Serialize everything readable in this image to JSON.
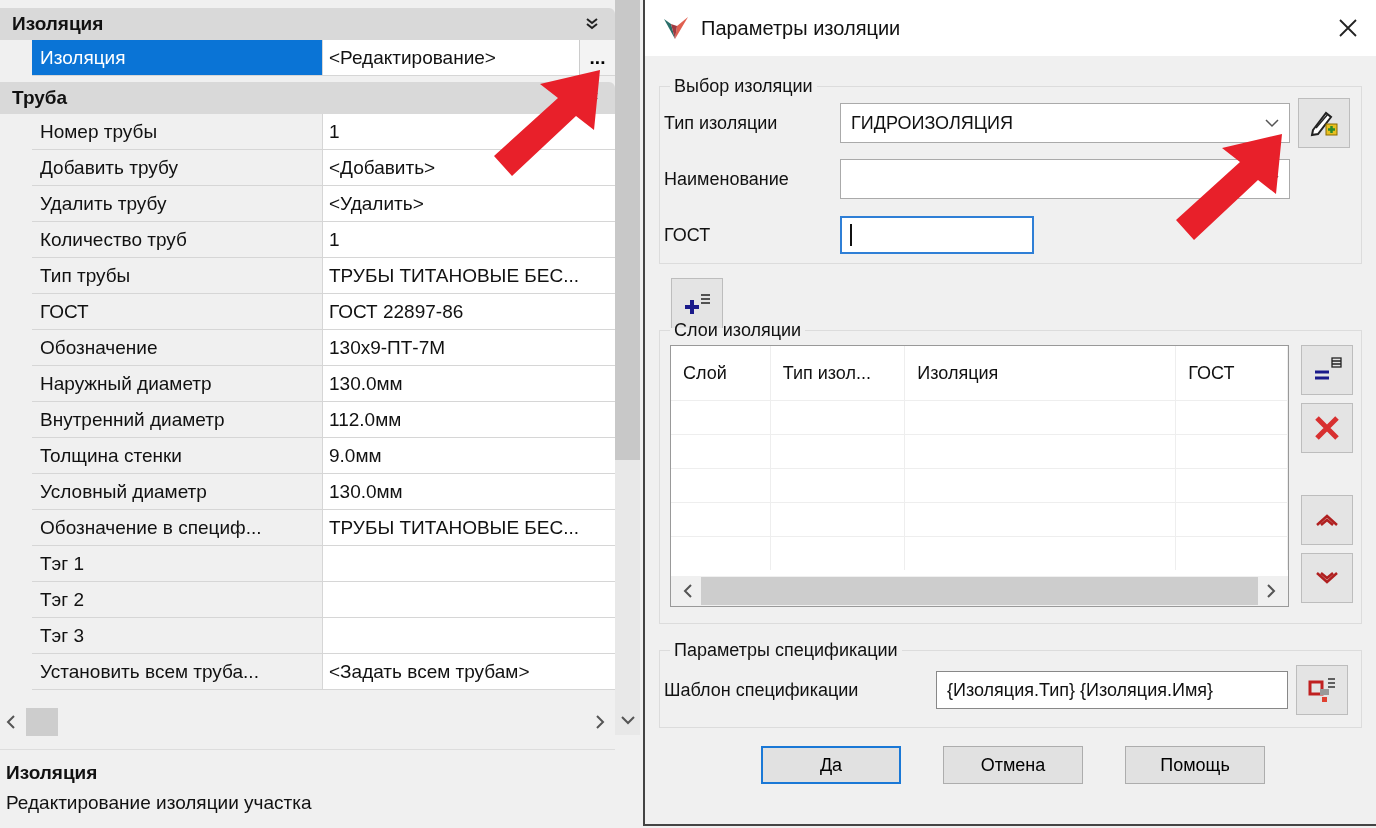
{
  "property_panel": {
    "categories": [
      {
        "title": "Изоляция",
        "rows": [
          {
            "label": "Изоляция",
            "value": "<Редактирование>",
            "selected": true,
            "button": "..."
          }
        ]
      },
      {
        "title": "Труба",
        "rows": [
          {
            "label": "Номер трубы",
            "value": "1",
            "selected": false
          },
          {
            "label": "Добавить трубу",
            "value": "<Добавить>",
            "selected": false
          },
          {
            "label": "Удалить трубу",
            "value": "<Удалить>",
            "selected": false
          },
          {
            "label": "Количество труб",
            "value": "1",
            "selected": false
          },
          {
            "label": "Тип трубы",
            "value": "ТРУБЫ ТИТАНОВЫЕ БЕС...",
            "selected": false
          },
          {
            "label": "ГОСТ",
            "value": "ГОСТ 22897-86",
            "selected": false
          },
          {
            "label": "Обозначение",
            "value": "130x9-ПТ-7М",
            "selected": false
          },
          {
            "label": "Наружный диаметр",
            "value": "130.0мм",
            "selected": false
          },
          {
            "label": "Внутренний диаметр",
            "value": "112.0мм",
            "selected": false
          },
          {
            "label": "Толщина стенки",
            "value": "9.0мм",
            "selected": false
          },
          {
            "label": "Условный диаметр",
            "value": "130.0мм",
            "selected": false
          },
          {
            "label": "Обозначение в специф...",
            "value": "ТРУБЫ ТИТАНОВЫЕ БЕС...",
            "selected": false
          },
          {
            "label": "Тэг 1",
            "selected": false
          },
          {
            "label": "Тэг 2",
            "selected": false
          },
          {
            "label": "Тэг 3",
            "selected": false
          },
          {
            "label": "Установить всем труба...",
            "value": "<Задать всем трубам>",
            "selected": false
          }
        ]
      }
    ]
  },
  "description": {
    "title": "Изоляция",
    "text": "Редактирование изоляции участка"
  },
  "dialog": {
    "title": "Параметры изоляции",
    "selection": {
      "title": "Выбор изоляции",
      "fields": [
        {
          "label": "Тип изоляции",
          "kind": "combo",
          "value": "ГИДРОИЗОЛЯЦИЯ",
          "focused": false
        },
        {
          "label": "Наименование",
          "kind": "combo",
          "focused": false
        },
        {
          "label": "ГОСТ",
          "kind": "input",
          "focused": true
        }
      ]
    },
    "layers": {
      "title": "Слои изоляции",
      "columns": [
        "Слой",
        "Тип изол...",
        "Изоляция",
        "ГОСТ"
      ]
    },
    "spec": {
      "title": "Параметры спецификации",
      "label": "Шаблон спецификации",
      "value": "{Изоляция.Тип} {Изоляция.Имя}"
    },
    "buttons": [
      {
        "label": "Да",
        "default": true
      },
      {
        "label": "Отмена",
        "default": false
      },
      {
        "label": "Помощь",
        "default": false
      }
    ]
  }
}
